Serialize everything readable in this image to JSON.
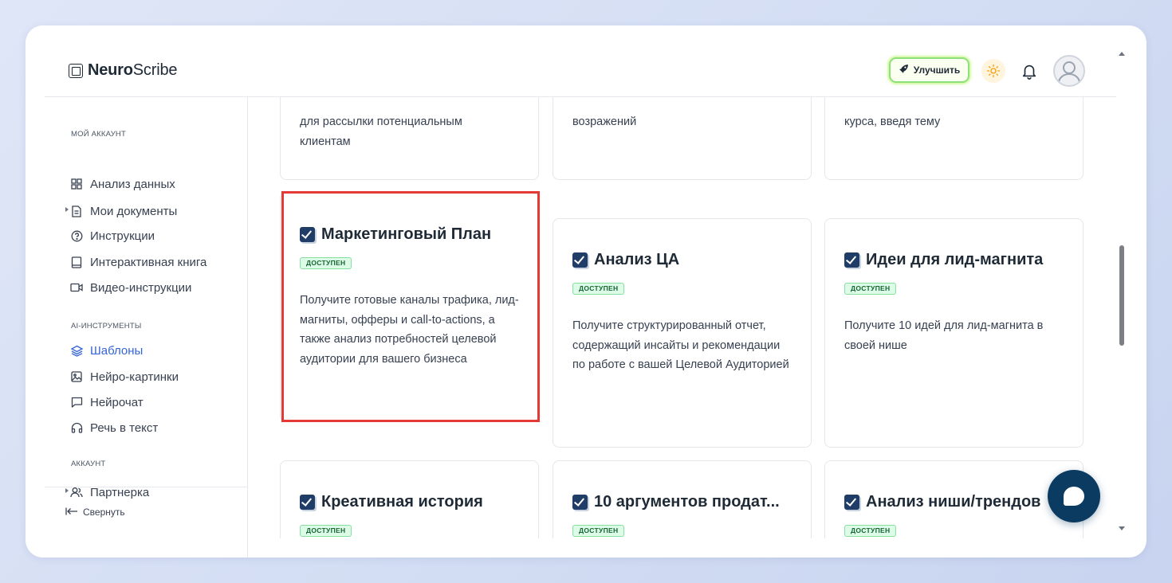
{
  "app": {
    "logo_bold": "Neuro",
    "logo_regular": "Scribe"
  },
  "header": {
    "upgrade_label": "Улучшить"
  },
  "sidebar": {
    "section_account": "Мой аккаунт",
    "section_ai": "AI-инструменты",
    "section_acc2": "Аккаунт",
    "items": [
      {
        "label": "Анализ данных",
        "icon": "grid-icon"
      },
      {
        "label": "Мои документы",
        "icon": "document-icon"
      },
      {
        "label": "Инструкции",
        "icon": "help-icon"
      },
      {
        "label": "Интерактивная книга",
        "icon": "book-icon"
      },
      {
        "label": "Видео-инструкции",
        "icon": "video-icon"
      },
      {
        "label": "Шаблоны",
        "icon": "layers-icon"
      },
      {
        "label": "Нейро-картинки",
        "icon": "image-icon"
      },
      {
        "label": "Нейрочат",
        "icon": "chat-icon"
      },
      {
        "label": "Речь в текст",
        "icon": "headphones-icon"
      },
      {
        "label": "Партнерка",
        "icon": "users-icon"
      }
    ],
    "collapse_label": "Свернуть"
  },
  "top_cards": [
    {
      "desc_line1": "для рассылки потенциальным",
      "desc_line2": "клиентам"
    },
    {
      "desc_line1": "возражений",
      "desc_line2": ""
    },
    {
      "desc_line1": "курса, введя тему",
      "desc_line2": ""
    }
  ],
  "cards": [
    {
      "title": "Маркетинговый План",
      "badge": "доступен",
      "desc": "Получите готовые каналы трафика, лид-магниты, офферы и call-to-actions, а также анализ потребностей целевой аудитории для вашего бизнеса"
    },
    {
      "title": "Анализ ЦА",
      "badge": "доступен",
      "desc": "Получите структурированный отчет, содержащий инсайты и рекомендации по работе с вашей Целевой Аудиторией"
    },
    {
      "title": "Идеи для лид-магнита",
      "badge": "доступен",
      "desc": "Получите 10 идей для лид-магнита в своей нише"
    },
    {
      "title": "Креативная история",
      "badge": "доступен",
      "desc": ""
    },
    {
      "title": "10 аргументов продат...",
      "badge": "доступен",
      "desc": ""
    },
    {
      "title": "Анализ ниши/трендов",
      "badge": "доступен",
      "desc": ""
    }
  ],
  "colors": {
    "accent": "#3565d6",
    "highlight": "#e53935",
    "chat_button": "#0c3b61",
    "badge_bg": "#dcfce7"
  }
}
